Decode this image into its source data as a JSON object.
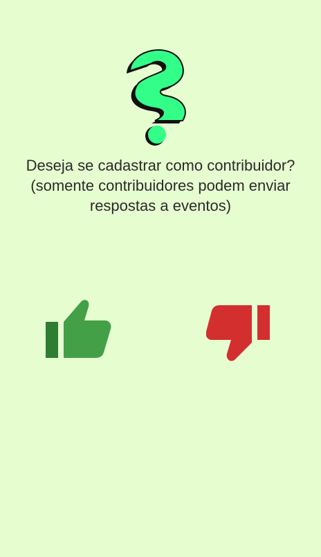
{
  "app": {
    "logo_icon": "question-mark-s-logo-icon"
  },
  "prompt": {
    "line1": "Deseja se cadastrar como contribuidor?",
    "line2": "(somente contribuidores podem enviar",
    "line3": "respostas a eventos)"
  },
  "actions": {
    "yes_icon": "thumbs-up-icon",
    "no_icon": "thumbs-down-icon"
  },
  "colors": {
    "background": "#e6fdd0",
    "logo_fill": "#33ff88",
    "yes_green": "#43a047",
    "yes_dark": "#2e7d32",
    "no_red": "#d32f2f",
    "text": "#2b2b2b"
  }
}
